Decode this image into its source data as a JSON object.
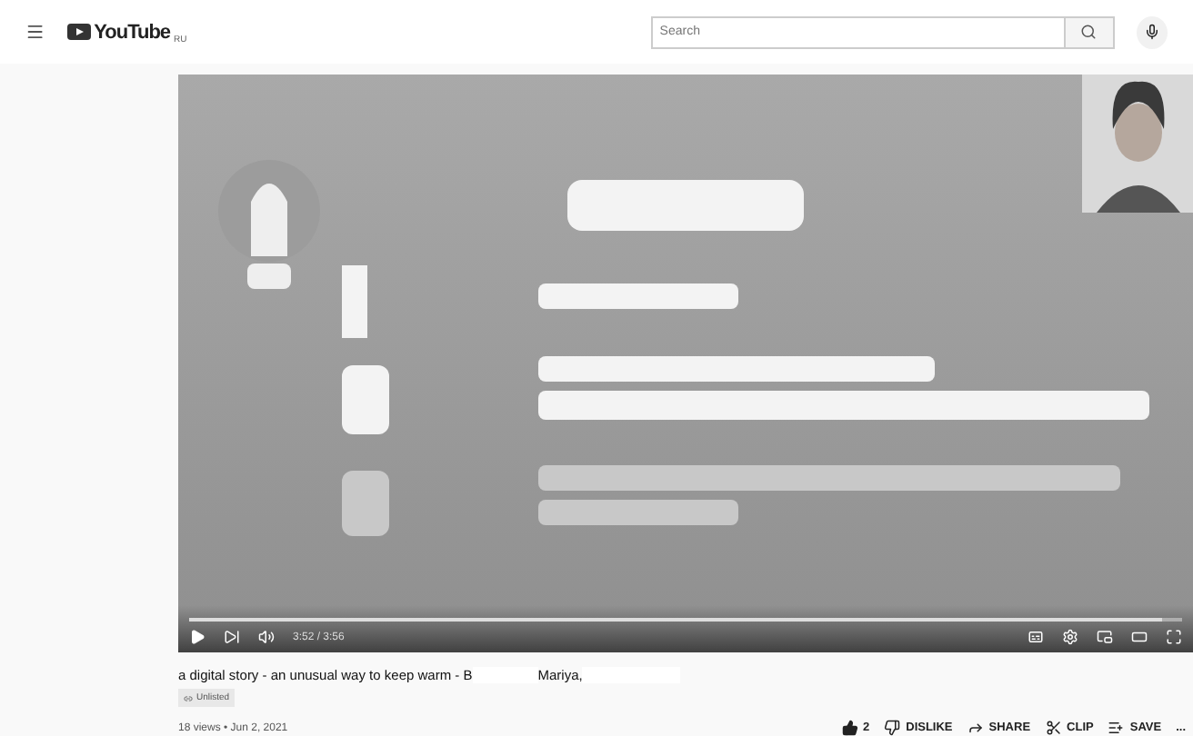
{
  "header": {
    "logo": "YouTube",
    "region": "RU",
    "search": {
      "placeholder": "Search"
    }
  },
  "player": {
    "progress": {
      "level": 0.98
    },
    "time": "3:52 / 3:56"
  },
  "video_info": {
    "title": "a digital story - an unusual way to keep warm - B",
    "title_end": "Mariya,",
    "badge": "Unlisted",
    "meta": "18 views • Jun 2, 2021",
    "actions": [
      {
        "kind": "like",
        "label": "2"
      },
      {
        "kind": "dislike",
        "label": "DISLIKE"
      },
      {
        "kind": "share",
        "label": "SHARE"
      },
      {
        "kind": "clip",
        "label": "CLIP"
      },
      {
        "kind": "save",
        "label": "SAVE"
      },
      {
        "kind": "more",
        "label": "..."
      }
    ]
  }
}
